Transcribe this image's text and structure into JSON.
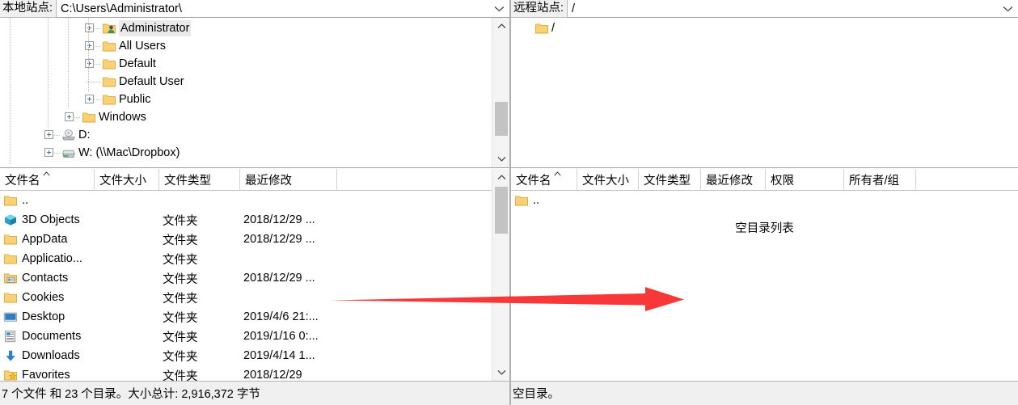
{
  "local": {
    "site_label": "本地站点:",
    "path": "C:\\Users\\Administrator\\",
    "tree": [
      {
        "label": "Administrator",
        "icon": "user-folder-icon",
        "depth": 3,
        "expandable": true,
        "selected": true
      },
      {
        "label": "All Users",
        "icon": "folder-icon",
        "depth": 3,
        "expandable": true,
        "selected": false
      },
      {
        "label": "Default",
        "icon": "folder-icon",
        "depth": 3,
        "expandable": true,
        "selected": false
      },
      {
        "label": "Default User",
        "icon": "folder-icon",
        "depth": 3,
        "expandable": false,
        "selected": false
      },
      {
        "label": "Public",
        "icon": "folder-icon",
        "depth": 3,
        "expandable": true,
        "selected": false
      },
      {
        "label": "Windows",
        "icon": "folder-icon",
        "depth": 2,
        "expandable": true,
        "selected": false
      },
      {
        "label": "D:",
        "icon": "cd-drive-icon",
        "depth": 1,
        "expandable": true,
        "selected": false
      },
      {
        "label": "W: (\\\\Mac\\Dropbox)",
        "icon": "network-drive-icon",
        "depth": 1,
        "expandable": true,
        "selected": false
      }
    ],
    "columns": [
      {
        "key": "name",
        "label": "文件名",
        "sort": "asc"
      },
      {
        "key": "size",
        "label": "文件大小"
      },
      {
        "key": "type",
        "label": "文件类型"
      },
      {
        "key": "modified",
        "label": "最近修改"
      }
    ],
    "rows": [
      {
        "name": "..",
        "icon": "folder-icon",
        "size": "",
        "type": "",
        "modified": ""
      },
      {
        "name": "3D Objects",
        "icon": "3d-objects-icon",
        "size": "",
        "type": "文件夹",
        "modified": "2018/12/29 ..."
      },
      {
        "name": "AppData",
        "icon": "folder-icon",
        "size": "",
        "type": "文件夹",
        "modified": "2018/12/29 ..."
      },
      {
        "name": "Applicatio...",
        "icon": "folder-icon",
        "size": "",
        "type": "文件夹",
        "modified": ""
      },
      {
        "name": "Contacts",
        "icon": "contacts-icon",
        "size": "",
        "type": "文件夹",
        "modified": "2018/12/29 ..."
      },
      {
        "name": "Cookies",
        "icon": "folder-icon",
        "size": "",
        "type": "文件夹",
        "modified": ""
      },
      {
        "name": "Desktop",
        "icon": "desktop-icon",
        "size": "",
        "type": "文件夹",
        "modified": "2019/4/6 21:..."
      },
      {
        "name": "Documents",
        "icon": "documents-icon",
        "size": "",
        "type": "文件夹",
        "modified": "2019/1/16 0:..."
      },
      {
        "name": "Downloads",
        "icon": "downloads-icon",
        "size": "",
        "type": "文件夹",
        "modified": "2019/4/14 1..."
      },
      {
        "name": "Favorites",
        "icon": "favorites-icon",
        "size": "",
        "type": "文件夹",
        "modified": "2018/12/29"
      }
    ],
    "status": "7 个文件 和 23 个目录。大小总计: 2,916,372 字节"
  },
  "remote": {
    "site_label": "远程站点:",
    "path": "/",
    "tree": [
      {
        "label": "/",
        "icon": "folder-icon",
        "depth": 0,
        "expandable": false,
        "selected": false
      }
    ],
    "columns": [
      {
        "key": "name",
        "label": "文件名",
        "sort": "asc"
      },
      {
        "key": "size",
        "label": "文件大小"
      },
      {
        "key": "type",
        "label": "文件类型"
      },
      {
        "key": "modified",
        "label": "最近修改"
      },
      {
        "key": "perms",
        "label": "权限"
      },
      {
        "key": "owner",
        "label": "所有者/组"
      }
    ],
    "rows": [
      {
        "name": "..",
        "icon": "folder-icon",
        "size": "",
        "type": "",
        "modified": "",
        "perms": "",
        "owner": ""
      }
    ],
    "empty_message": "空目录列表",
    "status": "空目录。"
  },
  "annotation": {
    "type": "arrow",
    "direction": "right",
    "color": "#f83838"
  },
  "icons": {
    "combo_arrow": "chevron-down-icon",
    "scroll_up": "chevron-up-icon",
    "scroll_down": "chevron-down-icon"
  }
}
